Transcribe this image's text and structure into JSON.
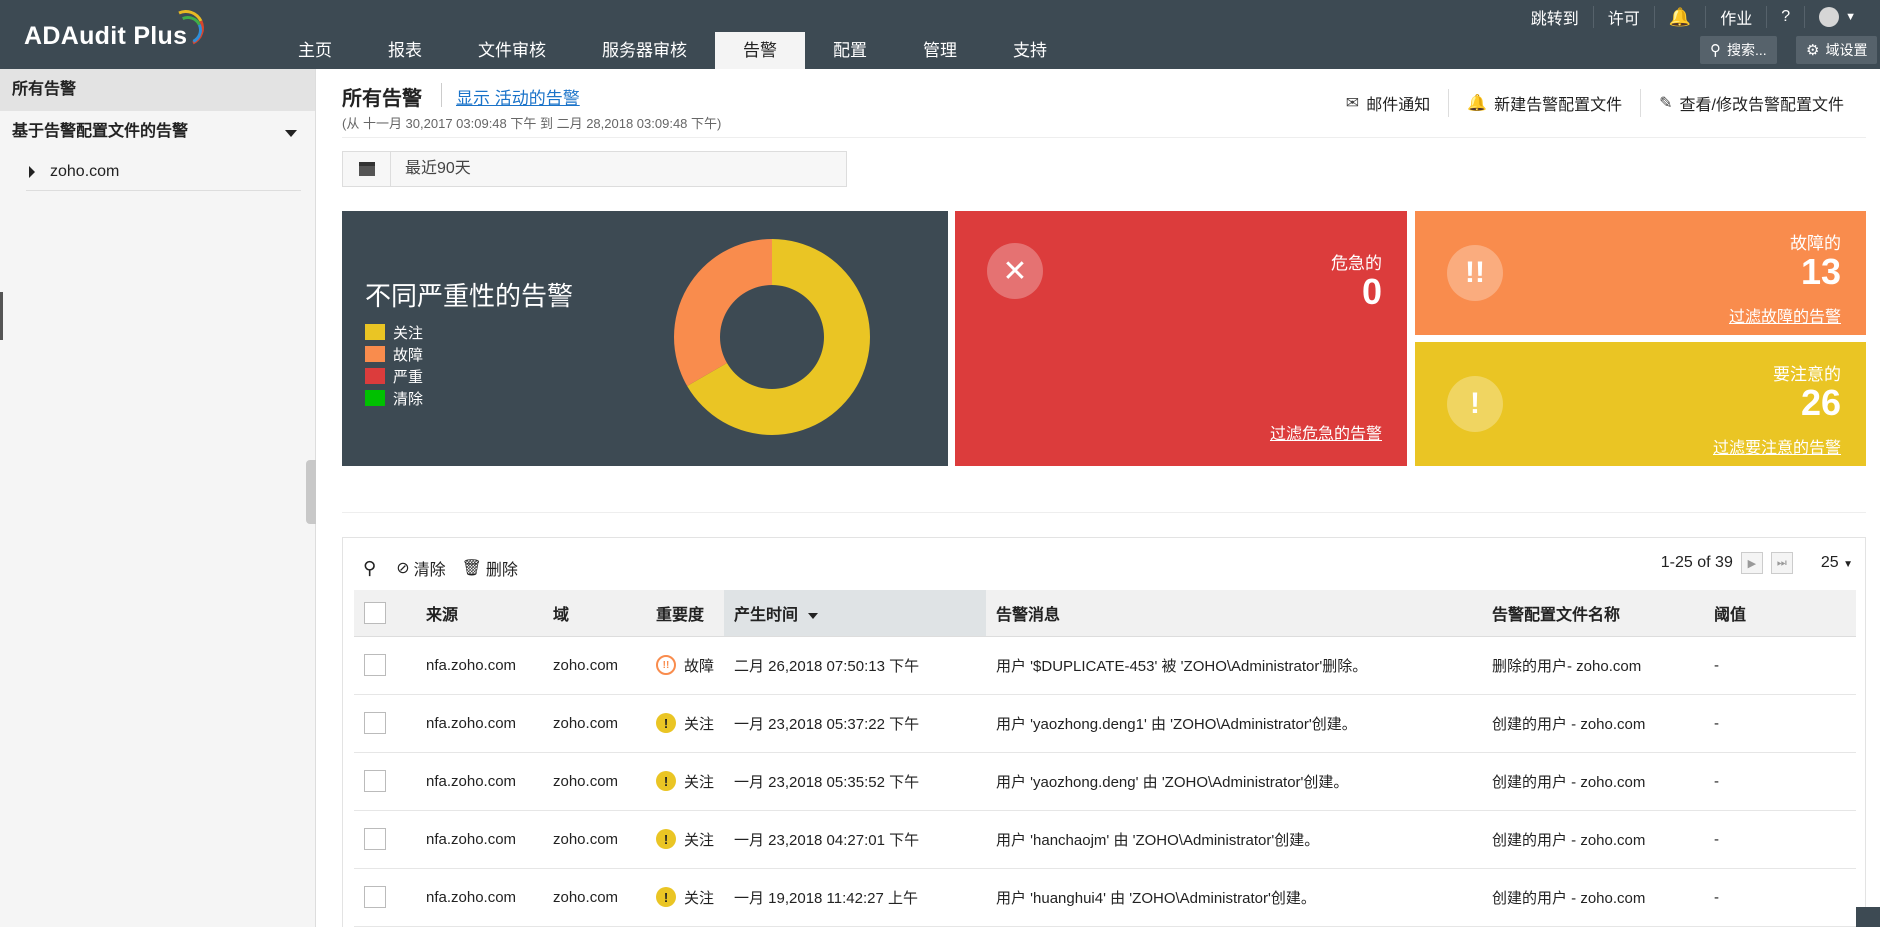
{
  "app": {
    "name": "ADAudit Plus"
  },
  "topnav": {
    "tabs": [
      {
        "label": "主页"
      },
      {
        "label": "报表"
      },
      {
        "label": "文件审核"
      },
      {
        "label": "服务器审核"
      },
      {
        "label": "告警",
        "active": true
      },
      {
        "label": "配置"
      },
      {
        "label": "管理"
      },
      {
        "label": "支持"
      }
    ]
  },
  "util": {
    "jump": "跳转到",
    "license": "许可",
    "jobs": "作业",
    "help": "?",
    "search": "搜索...",
    "domain_settings": "域设置"
  },
  "sidebar": {
    "header": "所有告警",
    "group": "基于告警配置文件的告警",
    "items": [
      {
        "label": "zoho.com"
      }
    ]
  },
  "main": {
    "title": "所有告警",
    "show_active_link": "显示 活动的告警",
    "range": "(从 十一月 30,2017 03:09:48 下午 到 二月 28,2018 03:09:48 下午)",
    "actions": {
      "email": "邮件通知",
      "new_profile": "新建告警配置文件",
      "edit_profile": "查看/修改告警配置文件"
    },
    "date_filter": "最近90天"
  },
  "summary": {
    "donut_title": "不同严重性的告警",
    "legend": [
      {
        "label": "关注",
        "color": "#eac524"
      },
      {
        "label": "故障",
        "color": "#f98c4d"
      },
      {
        "label": "严重",
        "color": "#dc3c3c"
      },
      {
        "label": "清除",
        "color": "#00c000"
      }
    ],
    "critical": {
      "label": "危急的",
      "value": "0",
      "link": "过滤危急的告警",
      "color": "#dc3c3c"
    },
    "trouble": {
      "label": "故障的",
      "value": "13",
      "link": "过滤故障的告警",
      "color": "#f98c4d"
    },
    "attention": {
      "label": "要注意的",
      "value": "26",
      "link": "过滤要注意的告警",
      "color": "#eac524"
    }
  },
  "table": {
    "toolbar": {
      "clear": "清除",
      "delete": "删除",
      "pagination": "1-25 of 39",
      "per_page": "25"
    },
    "columns": [
      "来源",
      "域",
      "重要度",
      "产生时间",
      "告警消息",
      "告警配置文件名称",
      "阈值"
    ],
    "rows": [
      {
        "source": "nfa.zoho.com",
        "domain": "zoho.com",
        "severity": "故障",
        "sev_type": "trouble",
        "time": "二月 26,2018 07:50:13 下午",
        "message": "用户 '$DUPLICATE-453' 被 'ZOHO\\Administrator'删除。",
        "profile": "删除的用户- zoho.com",
        "threshold": "-"
      },
      {
        "source": "nfa.zoho.com",
        "domain": "zoho.com",
        "severity": "关注",
        "sev_type": "attn",
        "time": "一月 23,2018 05:37:22 下午",
        "message": "用户 'yaozhong.deng1' 由 'ZOHO\\Administrator'创建。",
        "profile": "创建的用户 - zoho.com",
        "threshold": "-"
      },
      {
        "source": "nfa.zoho.com",
        "domain": "zoho.com",
        "severity": "关注",
        "sev_type": "attn",
        "time": "一月 23,2018 05:35:52 下午",
        "message": "用户 'yaozhong.deng' 由 'ZOHO\\Administrator'创建。",
        "profile": "创建的用户 - zoho.com",
        "threshold": "-"
      },
      {
        "source": "nfa.zoho.com",
        "domain": "zoho.com",
        "severity": "关注",
        "sev_type": "attn",
        "time": "一月 23,2018 04:27:01 下午",
        "message": "用户 'hanchaojm' 由 'ZOHO\\Administrator'创建。",
        "profile": "创建的用户 - zoho.com",
        "threshold": "-"
      },
      {
        "source": "nfa.zoho.com",
        "domain": "zoho.com",
        "severity": "关注",
        "sev_type": "attn",
        "time": "一月 19,2018 11:42:27 上午",
        "message": "用户 'huanghui4' 由 'ZOHO\\Administrator'创建。",
        "profile": "创建的用户 - zoho.com",
        "threshold": "-"
      }
    ]
  }
}
